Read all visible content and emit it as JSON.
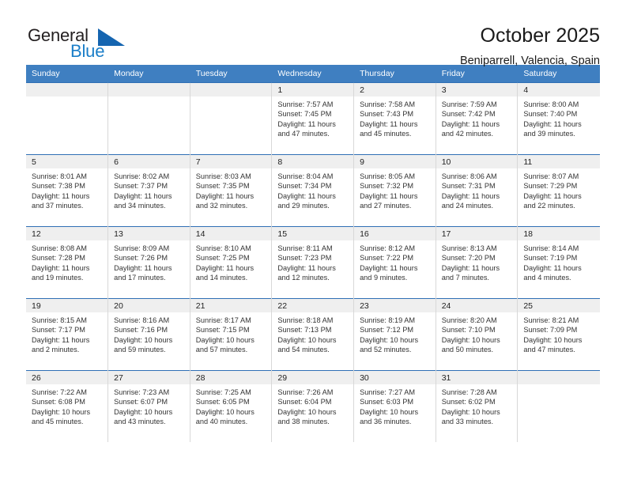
{
  "brand": {
    "name_part1": "General",
    "name_part2": "Blue",
    "triangle_color": "#1565b0",
    "blue_text_color": "#1a7ec8"
  },
  "header": {
    "title": "October 2025",
    "location": "Beniparrell, Valencia, Spain"
  },
  "theme": {
    "header_row_bg": "#3f7fc1",
    "row_border": "#2f6fb5",
    "daynum_bg": "#efefef"
  },
  "weekday_headers": [
    "Sunday",
    "Monday",
    "Tuesday",
    "Wednesday",
    "Thursday",
    "Friday",
    "Saturday"
  ],
  "labels": {
    "sunrise_prefix": "Sunrise:",
    "sunset_prefix": "Sunset:",
    "daylight_prefix": "Daylight:"
  },
  "weeks": [
    [
      {
        "day": "",
        "empty": true
      },
      {
        "day": "",
        "empty": true
      },
      {
        "day": "",
        "empty": true
      },
      {
        "day": "1",
        "sunrise": "Sunrise: 7:57 AM",
        "sunset": "Sunset: 7:45 PM",
        "daylight_line1": "Daylight: 11 hours",
        "daylight_line2": "and 47 minutes."
      },
      {
        "day": "2",
        "sunrise": "Sunrise: 7:58 AM",
        "sunset": "Sunset: 7:43 PM",
        "daylight_line1": "Daylight: 11 hours",
        "daylight_line2": "and 45 minutes."
      },
      {
        "day": "3",
        "sunrise": "Sunrise: 7:59 AM",
        "sunset": "Sunset: 7:42 PM",
        "daylight_line1": "Daylight: 11 hours",
        "daylight_line2": "and 42 minutes."
      },
      {
        "day": "4",
        "sunrise": "Sunrise: 8:00 AM",
        "sunset": "Sunset: 7:40 PM",
        "daylight_line1": "Daylight: 11 hours",
        "daylight_line2": "and 39 minutes."
      }
    ],
    [
      {
        "day": "5",
        "sunrise": "Sunrise: 8:01 AM",
        "sunset": "Sunset: 7:38 PM",
        "daylight_line1": "Daylight: 11 hours",
        "daylight_line2": "and 37 minutes."
      },
      {
        "day": "6",
        "sunrise": "Sunrise: 8:02 AM",
        "sunset": "Sunset: 7:37 PM",
        "daylight_line1": "Daylight: 11 hours",
        "daylight_line2": "and 34 minutes."
      },
      {
        "day": "7",
        "sunrise": "Sunrise: 8:03 AM",
        "sunset": "Sunset: 7:35 PM",
        "daylight_line1": "Daylight: 11 hours",
        "daylight_line2": "and 32 minutes."
      },
      {
        "day": "8",
        "sunrise": "Sunrise: 8:04 AM",
        "sunset": "Sunset: 7:34 PM",
        "daylight_line1": "Daylight: 11 hours",
        "daylight_line2": "and 29 minutes."
      },
      {
        "day": "9",
        "sunrise": "Sunrise: 8:05 AM",
        "sunset": "Sunset: 7:32 PM",
        "daylight_line1": "Daylight: 11 hours",
        "daylight_line2": "and 27 minutes."
      },
      {
        "day": "10",
        "sunrise": "Sunrise: 8:06 AM",
        "sunset": "Sunset: 7:31 PM",
        "daylight_line1": "Daylight: 11 hours",
        "daylight_line2": "and 24 minutes."
      },
      {
        "day": "11",
        "sunrise": "Sunrise: 8:07 AM",
        "sunset": "Sunset: 7:29 PM",
        "daylight_line1": "Daylight: 11 hours",
        "daylight_line2": "and 22 minutes."
      }
    ],
    [
      {
        "day": "12",
        "sunrise": "Sunrise: 8:08 AM",
        "sunset": "Sunset: 7:28 PM",
        "daylight_line1": "Daylight: 11 hours",
        "daylight_line2": "and 19 minutes."
      },
      {
        "day": "13",
        "sunrise": "Sunrise: 8:09 AM",
        "sunset": "Sunset: 7:26 PM",
        "daylight_line1": "Daylight: 11 hours",
        "daylight_line2": "and 17 minutes."
      },
      {
        "day": "14",
        "sunrise": "Sunrise: 8:10 AM",
        "sunset": "Sunset: 7:25 PM",
        "daylight_line1": "Daylight: 11 hours",
        "daylight_line2": "and 14 minutes."
      },
      {
        "day": "15",
        "sunrise": "Sunrise: 8:11 AM",
        "sunset": "Sunset: 7:23 PM",
        "daylight_line1": "Daylight: 11 hours",
        "daylight_line2": "and 12 minutes."
      },
      {
        "day": "16",
        "sunrise": "Sunrise: 8:12 AM",
        "sunset": "Sunset: 7:22 PM",
        "daylight_line1": "Daylight: 11 hours",
        "daylight_line2": "and 9 minutes."
      },
      {
        "day": "17",
        "sunrise": "Sunrise: 8:13 AM",
        "sunset": "Sunset: 7:20 PM",
        "daylight_line1": "Daylight: 11 hours",
        "daylight_line2": "and 7 minutes."
      },
      {
        "day": "18",
        "sunrise": "Sunrise: 8:14 AM",
        "sunset": "Sunset: 7:19 PM",
        "daylight_line1": "Daylight: 11 hours",
        "daylight_line2": "and 4 minutes."
      }
    ],
    [
      {
        "day": "19",
        "sunrise": "Sunrise: 8:15 AM",
        "sunset": "Sunset: 7:17 PM",
        "daylight_line1": "Daylight: 11 hours",
        "daylight_line2": "and 2 minutes."
      },
      {
        "day": "20",
        "sunrise": "Sunrise: 8:16 AM",
        "sunset": "Sunset: 7:16 PM",
        "daylight_line1": "Daylight: 10 hours",
        "daylight_line2": "and 59 minutes."
      },
      {
        "day": "21",
        "sunrise": "Sunrise: 8:17 AM",
        "sunset": "Sunset: 7:15 PM",
        "daylight_line1": "Daylight: 10 hours",
        "daylight_line2": "and 57 minutes."
      },
      {
        "day": "22",
        "sunrise": "Sunrise: 8:18 AM",
        "sunset": "Sunset: 7:13 PM",
        "daylight_line1": "Daylight: 10 hours",
        "daylight_line2": "and 54 minutes."
      },
      {
        "day": "23",
        "sunrise": "Sunrise: 8:19 AM",
        "sunset": "Sunset: 7:12 PM",
        "daylight_line1": "Daylight: 10 hours",
        "daylight_line2": "and 52 minutes."
      },
      {
        "day": "24",
        "sunrise": "Sunrise: 8:20 AM",
        "sunset": "Sunset: 7:10 PM",
        "daylight_line1": "Daylight: 10 hours",
        "daylight_line2": "and 50 minutes."
      },
      {
        "day": "25",
        "sunrise": "Sunrise: 8:21 AM",
        "sunset": "Sunset: 7:09 PM",
        "daylight_line1": "Daylight: 10 hours",
        "daylight_line2": "and 47 minutes."
      }
    ],
    [
      {
        "day": "26",
        "sunrise": "Sunrise: 7:22 AM",
        "sunset": "Sunset: 6:08 PM",
        "daylight_line1": "Daylight: 10 hours",
        "daylight_line2": "and 45 minutes."
      },
      {
        "day": "27",
        "sunrise": "Sunrise: 7:23 AM",
        "sunset": "Sunset: 6:07 PM",
        "daylight_line1": "Daylight: 10 hours",
        "daylight_line2": "and 43 minutes."
      },
      {
        "day": "28",
        "sunrise": "Sunrise: 7:25 AM",
        "sunset": "Sunset: 6:05 PM",
        "daylight_line1": "Daylight: 10 hours",
        "daylight_line2": "and 40 minutes."
      },
      {
        "day": "29",
        "sunrise": "Sunrise: 7:26 AM",
        "sunset": "Sunset: 6:04 PM",
        "daylight_line1": "Daylight: 10 hours",
        "daylight_line2": "and 38 minutes."
      },
      {
        "day": "30",
        "sunrise": "Sunrise: 7:27 AM",
        "sunset": "Sunset: 6:03 PM",
        "daylight_line1": "Daylight: 10 hours",
        "daylight_line2": "and 36 minutes."
      },
      {
        "day": "31",
        "sunrise": "Sunrise: 7:28 AM",
        "sunset": "Sunset: 6:02 PM",
        "daylight_line1": "Daylight: 10 hours",
        "daylight_line2": "and 33 minutes."
      },
      {
        "day": "",
        "empty": true
      }
    ]
  ]
}
